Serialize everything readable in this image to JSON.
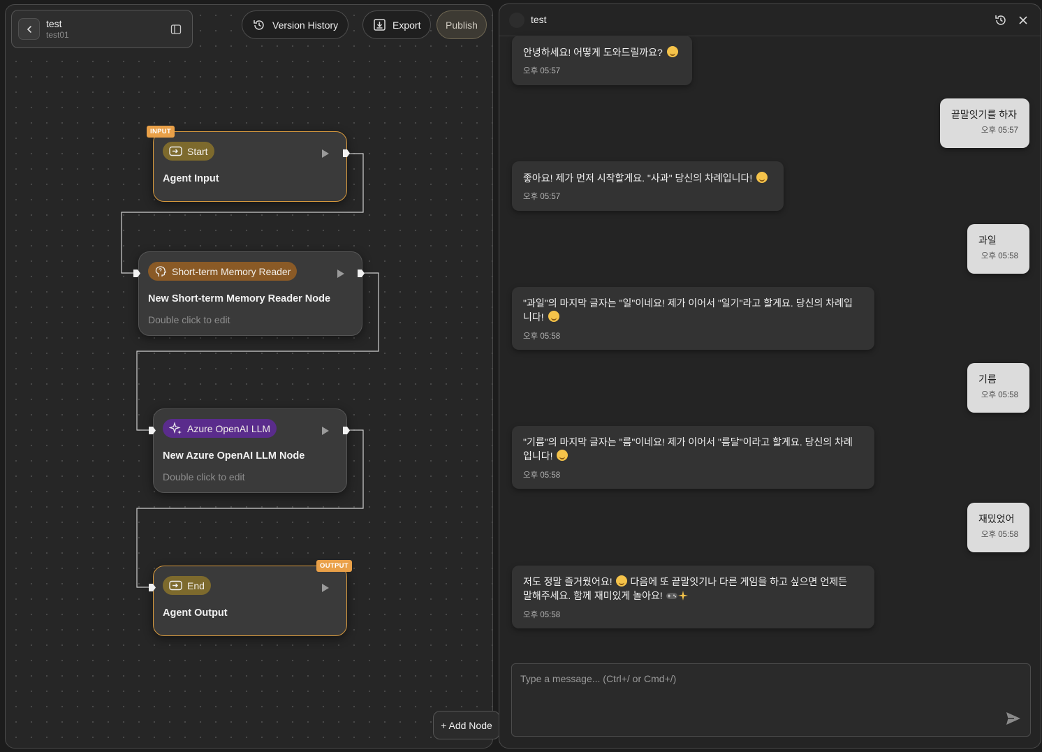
{
  "project": {
    "title": "test",
    "subtitle": "test01"
  },
  "toolbar": {
    "version_history": "Version History",
    "export": "Export",
    "publish": "Publish"
  },
  "nodes": {
    "start": {
      "tag": "INPUT",
      "chip": "Start",
      "title": "Agent Input"
    },
    "memory": {
      "chip": "Short-term Memory Reader",
      "title": "New Short-term Memory Reader Node",
      "hint": "Double click to edit"
    },
    "llm": {
      "chip": "Azure OpenAI LLM",
      "title": "New Azure OpenAI LLM Node",
      "hint": "Double click to edit"
    },
    "end": {
      "tag": "OUTPUT",
      "chip": "End",
      "title": "Agent Output"
    }
  },
  "add_node": "+ Add Node",
  "chat": {
    "title": "test",
    "messages": [
      {
        "role": "bot",
        "line1": "안녕하세요! 어떻게 도와드릴까요?",
        "line2": "",
        "time": "오후 05:57"
      },
      {
        "role": "user",
        "line1": "끝말잇기를 하자",
        "time": "오후 05:57"
      },
      {
        "role": "bot",
        "line1": "좋아요! 제가 먼저 시작할게요. \"사과\" 당신의 차례입니다!",
        "line2": "",
        "time": "오후 05:57"
      },
      {
        "role": "user",
        "line1": "과일",
        "time": "오후 05:58"
      },
      {
        "role": "bot",
        "line1": "\"과일\"의 마지막 글자는 \"일\"이네요! 제가 이어서 \"일기\"라고 할게요. 당신의 차례입",
        "line2": "니다!",
        "time": "오후 05:58"
      },
      {
        "role": "user",
        "line1": "기름",
        "time": "오후 05:58"
      },
      {
        "role": "bot",
        "line1": "\"기름\"의 마지막 글자는 \"름\"이네요! 제가 이어서 \"름달\"이라고 할게요. 당신의 차례",
        "line2": "입니다!",
        "time": "오후 05:58"
      },
      {
        "role": "user",
        "line1": "재밌었어",
        "time": "오후 05:58"
      },
      {
        "role": "bot",
        "line1a": "저도 정말 즐거웠어요!",
        "line1b": "다음에 또 끝말잇기나 다른 게임을 하고 싶으면 언제든",
        "line2": "말해주세요. 함께 재미있게 놀아요!",
        "time": "오후 05:58"
      }
    ],
    "input_placeholder": "Type a message... (Ctrl+/ or Cmd+/)"
  },
  "colors": {
    "io_border": "#d89a3e",
    "tag_bg": "#e9a048",
    "chip_start": "#7d6a2d",
    "chip_memory": "#8a5a26",
    "chip_llm": "#5a2c8c"
  },
  "icons": [
    "chevron-left-icon",
    "sidebar-panel-icon",
    "history-icon",
    "export-icon",
    "login-icon",
    "brain-icon",
    "sparkles-icon",
    "play-icon",
    "close-icon",
    "send-icon",
    "gamepad-emoji",
    "sparkles-emoji",
    "smile-emoji"
  ]
}
